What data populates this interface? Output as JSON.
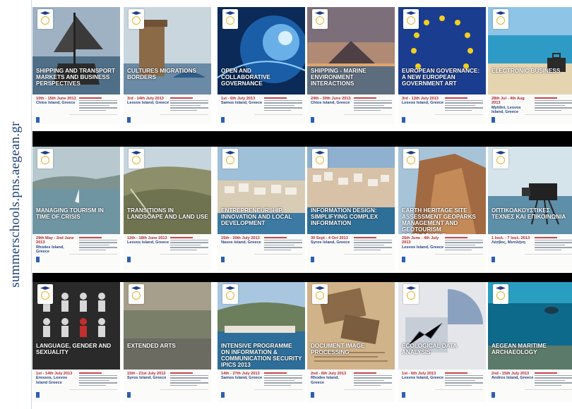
{
  "sidebar": {
    "url": "summerschools.pns.aegean.gr"
  },
  "rows": [
    [
      {
        "title": "SHIPPING AND TRANSPORT MARKETS AND BUSINESS PERSPECTIVES",
        "date": "10th - 15th June 2013",
        "place": "Chios Island, Greece",
        "scene": "ship"
      },
      {
        "title": "CULTURES MIGRATIONS BORDERS",
        "date": "3rd - 14th July 2013",
        "place": "Lesvos Island, Greece",
        "scene": "tower"
      },
      {
        "title": "OPEN AND COLLABORATIVE GOVERNANCE",
        "date": "1st - 6th July 2013",
        "place": "Samos Island, Greece",
        "scene": "digital"
      },
      {
        "title": "SHIPPING - MARINE ENVIRONMENT INTERACTIONS",
        "date": "24th - 30th June 2013",
        "place": "Chios Island, Greece",
        "scene": "sunset"
      },
      {
        "title": "EUROPEAN GOVERNANCE: A NEW EUROPEAN GOVERNMENT ART",
        "date": "3rd - 13th July 2013",
        "place": "Lesvos Island, Greece",
        "scene": "eu"
      },
      {
        "title": "ELECTRONIC BUSINESS",
        "date": "28th Jul - 4th Aug 2013",
        "place": "Mytilini, Lesvos Island, Greece",
        "scene": "beach"
      }
    ],
    [
      {
        "title": "MANAGING TOURISM IN TIME OF CRISIS",
        "date": "29th May - 2nd June 2013",
        "place": "Rhodes Island, Greece",
        "scene": "bay"
      },
      {
        "title": "TRANSITIONS IN LANDSCAPE AND LAND USE",
        "date": "12th - 18th June 2013",
        "place": "Lesvos Island, Greece",
        "scene": "hills"
      },
      {
        "title": "ENTREPRENEURSHIP, INNOVATION AND LOCAL DEVELOPMENT",
        "date": "15th - 20th July 2013",
        "place": "Naxos Island, Greece",
        "scene": "town"
      },
      {
        "title": "INFORMATION DESIGN: SIMPLIFYING COMPLEX INFORMATION",
        "date": "30 Sept - 4 Oct 2013",
        "place": "Syros Island, Greece",
        "scene": "harbor"
      },
      {
        "title": "EARTH HERITAGE SITE ASSESSMENT GEOPARKS MANAGEMENT AND GEOTOURISM DEVELOPMENT",
        "date": "25th June - 4th July 2013",
        "place": "Lesvos Island, Greece",
        "scene": "cliff"
      },
      {
        "title": "ΟΠΤΙΚΟΑΚΟΥΣΤΙΚΕΣ ΤΕΧΝΕΣ ΚΑΙ ΕΠΙΚΟΙΝΩΝΙΑ",
        "date": "1 Ιουλ. - 7 Ιουλ. 2013",
        "place": "Λέσβος, Μυτιλήνη",
        "scene": "camera"
      }
    ],
    [
      {
        "title": "LANGUAGE, GENDER AND SEXUALITY",
        "date": "1st - 14th July 2013",
        "place": "Eressos, Lesvos Island Greece",
        "scene": "figures"
      },
      {
        "title": "EXTENDED ARTS",
        "date": "15th - 21st July 2013",
        "place": "Syros Island, Greece",
        "scene": "noise"
      },
      {
        "title": "INTENSIVE PROGRAMME ON INFORMATION & COMMUNICATION SECURITY IPICS 2013",
        "date": "14th - 27th July 2013",
        "place": "Samos Island, Greece",
        "scene": "port"
      },
      {
        "title": "DOCUMENT IMAGE PROCESSING",
        "date": "2nd - 6th July 2013",
        "place": "Rhodes Island, Greece",
        "scene": "manuscript"
      },
      {
        "title": "ECOLOGICAL DATA ANALYSIS",
        "date": "1st - 6th July 2013",
        "place": "Lesvos Island, Greece",
        "scene": "data"
      },
      {
        "title": "AEGEAN MARITIME ARCHAEOLOGY",
        "date": "2nd - 15th July 2013",
        "place": "Andros Island, Greece",
        "scene": "underwater"
      }
    ]
  ],
  "colors": {
    "date": "#b5232b",
    "place": "#1e3f86",
    "sidebar_text": "#1f3f7a"
  }
}
